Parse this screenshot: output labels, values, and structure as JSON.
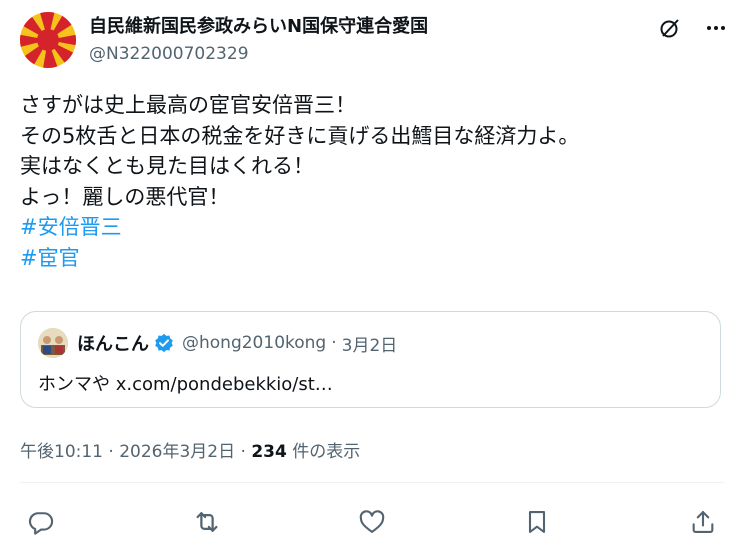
{
  "author": {
    "display_name": "自民維新国民参政みらいN国保守連合愛国",
    "handle": "@N322000702329",
    "avatar_icon": "rising-sun-flag-avatar"
  },
  "tweet": {
    "lines": [
      "さすがは史上最高の宦官安倍晋三！",
      "その5枚舌と日本の税金を好きに貢げる出鱈目な経済力よ。",
      "実はなくとも見た目はくれる！",
      "よっ！麗しの悪代官！"
    ],
    "hashtags": [
      "#安倍晋三",
      "#宦官"
    ]
  },
  "quote": {
    "display_name": "ほんこん",
    "handle": "@hong2010kong",
    "separator": "·",
    "date": "3月2日",
    "text": "ホンマや x.com/pondebekkio/st…"
  },
  "meta": {
    "time": "午後10:11",
    "separator1": "·",
    "date": "2026年3月2日",
    "separator2": "·",
    "views_count": "234",
    "views_label": "件の表示"
  },
  "colors": {
    "accent": "#1d9bf0",
    "text": "#0f1419",
    "secondary": "#536471",
    "border": "#cfd9de",
    "sun_red": "#d5232b",
    "sun_gold": "#f6c21c"
  },
  "icons": {
    "top": [
      "grok-icon",
      "more-icon"
    ],
    "actions": [
      "reply-icon",
      "retweet-icon",
      "like-icon",
      "bookmark-icon",
      "share-icon"
    ]
  }
}
